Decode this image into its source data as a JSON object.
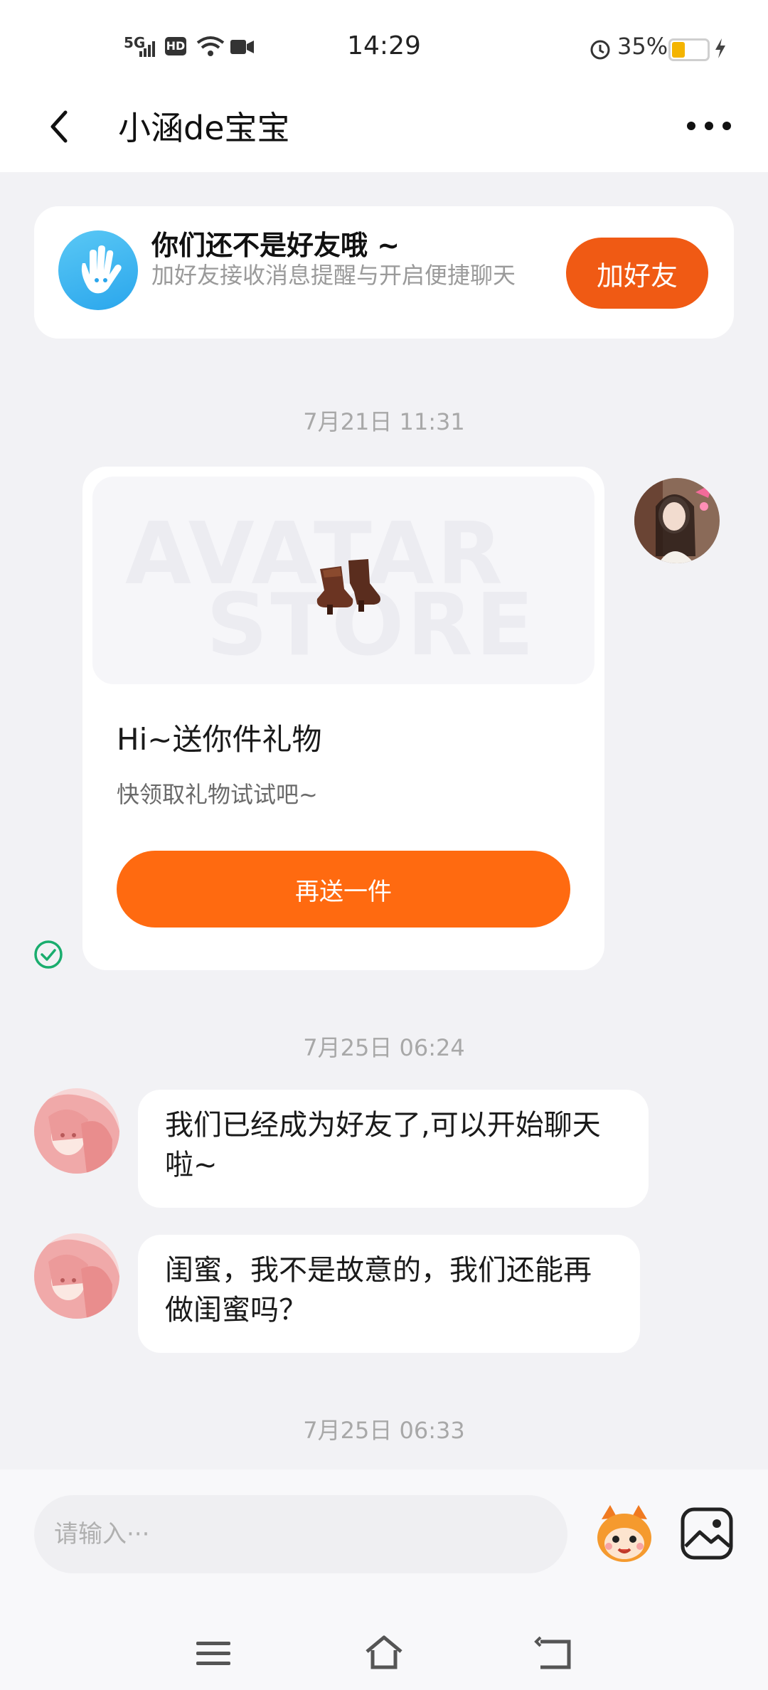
{
  "status_bar": {
    "time": "14:29",
    "battery": "35%",
    "network": "5G",
    "hd": "HD"
  },
  "header": {
    "title": "小涵de宝宝"
  },
  "banner": {
    "title": "你们还不是好友哦 ~",
    "subtitle": "加好友接收消息提醒与开启便捷聊天",
    "button": "加好友"
  },
  "messages": {
    "ts1": "7月21日 11:31",
    "gift": {
      "watermark_1": "AVATAR",
      "watermark_2": "STORE",
      "title": "Hi~送你件礼物",
      "subtitle": "快领取礼物试试吧~",
      "button": "再送一件"
    },
    "ts2": "7月25日 06:24",
    "msg1": "我们已经成为好友了,可以开始聊天啦~",
    "msg2": "闺蜜，我不是故意的，我们还能再做闺蜜吗？",
    "ts3": "7月25日 06:33"
  },
  "input": {
    "placeholder": "请输入···"
  },
  "colors": {
    "accent": "#ff6a10",
    "banner_button": "#f05a14"
  }
}
